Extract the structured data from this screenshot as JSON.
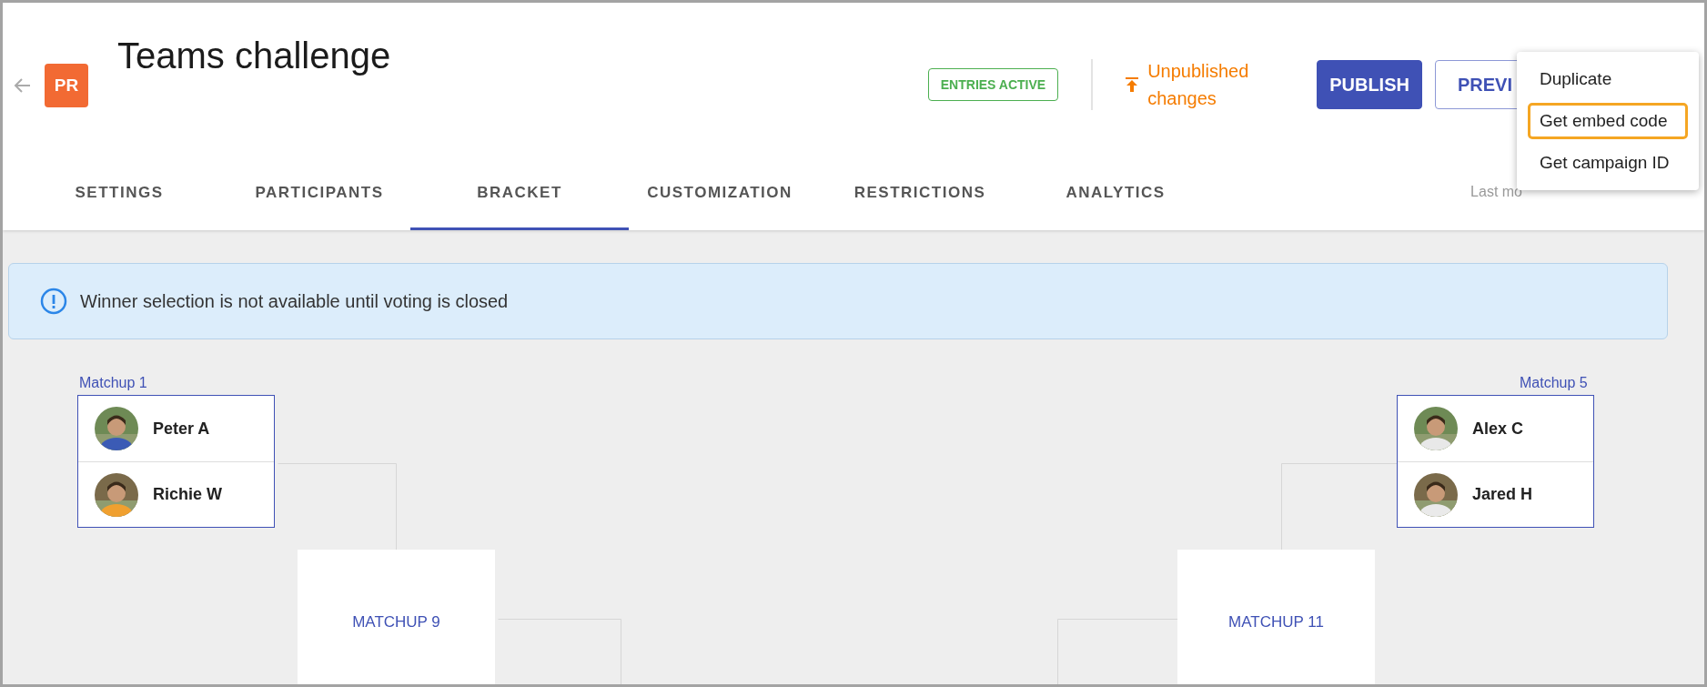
{
  "header": {
    "logo": "PR",
    "title": "Teams challenge",
    "status_badge": "ENTRIES ACTIVE",
    "unpublished": {
      "text": "Unpublished changes"
    },
    "buttons": [
      {
        "label": "PUBLISH",
        "kind": "primary"
      },
      {
        "label": "PREVI",
        "kind": "outline"
      }
    ]
  },
  "tabs": [
    {
      "label": "SETTINGS",
      "selected": false
    },
    {
      "label": "PARTICIPANTS",
      "selected": false
    },
    {
      "label": "BRACKET",
      "selected": true
    },
    {
      "label": "CUSTOMIZATION",
      "selected": false
    },
    {
      "label": "RESTRICTIONS",
      "selected": false
    },
    {
      "label": "ANALYTICS",
      "selected": false
    }
  ],
  "last_modified": "Last mo",
  "menu": [
    {
      "label": "Duplicate",
      "selected": false
    },
    {
      "label": "Get embed code",
      "selected": true
    },
    {
      "label": "Get campaign ID",
      "selected": false
    }
  ],
  "alert": {
    "text": "Winner selection is not available until voting is closed"
  },
  "bracket": {
    "left": [
      {
        "kind": "pair",
        "label": "Matchup 1",
        "players": [
          {
            "name": "Peter A"
          },
          {
            "name": "Richie W"
          }
        ]
      },
      {
        "kind": "empty",
        "label": "MATCHUP 9"
      }
    ],
    "right": [
      {
        "kind": "pair",
        "label": "Matchup 5",
        "players": [
          {
            "name": "Alex C"
          },
          {
            "name": "Jared H"
          }
        ]
      },
      {
        "kind": "empty",
        "label": "MATCHUP 11"
      }
    ]
  }
}
